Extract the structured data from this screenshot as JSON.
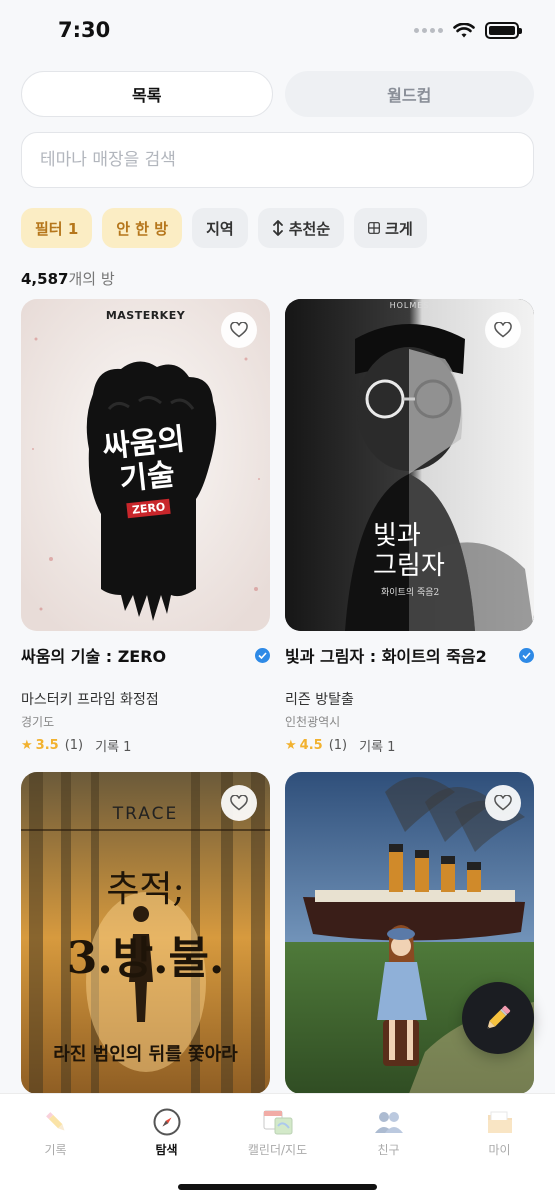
{
  "status": {
    "time": "7:30"
  },
  "tabs": [
    {
      "label": "목록",
      "active": true
    },
    {
      "label": "월드컵",
      "active": false
    }
  ],
  "search": {
    "placeholder": "테마나 매장을 검색",
    "value": ""
  },
  "filters": [
    {
      "label": "필터 1",
      "style": "yellow",
      "icon": ""
    },
    {
      "label": "안 한 방",
      "style": "yellow",
      "icon": ""
    },
    {
      "label": "지역",
      "style": "gray",
      "icon": ""
    },
    {
      "label": "추천순",
      "style": "gray",
      "icon": "sort-arrows-icon"
    },
    {
      "label": "크게",
      "style": "gray",
      "icon": "grid-icon"
    }
  ],
  "result_count": {
    "number": "4,587",
    "suffix": "개의 방"
  },
  "cards": [
    {
      "title": "싸움의 기술 : ZERO",
      "verified": true,
      "store": "마스터키 프라임 화정점",
      "region": "경기도",
      "rating": "3.5",
      "reviews": "(1)",
      "records": "기록 1",
      "poster": {
        "brand": "MASTERKEY",
        "headline_1": "싸움의",
        "headline_2": "기술",
        "tag": "ZERO"
      }
    },
    {
      "title": "빛과 그림자 : 화이트의 죽음2",
      "verified": true,
      "store": "리즌 방탈출",
      "region": "인천광역시",
      "rating": "4.5",
      "reviews": "(1)",
      "records": "기록 1",
      "poster": {
        "brand": "HOLMES",
        "headline_1": "빛과",
        "headline_2": "그림자",
        "tag": "화이트의 죽음2"
      }
    },
    {
      "poster": {
        "brand": "TRACE",
        "headline_1": "추적;",
        "headline_2": "3.방.불.",
        "tag": "라진 범인의 뒤를 쫓아라"
      }
    },
    {
      "poster": {
        "brand": "",
        "headline_1": "",
        "headline_2": "",
        "tag": ""
      }
    }
  ],
  "tabbar": [
    {
      "label": "기록",
      "icon": "pencil-icon",
      "active": false
    },
    {
      "label": "탐색",
      "icon": "compass-icon",
      "active": true
    },
    {
      "label": "캘린더/지도",
      "icon": "calendar-map-icon",
      "active": false
    },
    {
      "label": "친구",
      "icon": "friends-icon",
      "active": false
    },
    {
      "label": "마이",
      "icon": "folder-icon",
      "active": false
    }
  ],
  "colors": {
    "accent_yellow": "#fbedc4",
    "accent_yellow_text": "#b5761b",
    "star": "#f2b230",
    "verified": "#2e8ae6"
  }
}
